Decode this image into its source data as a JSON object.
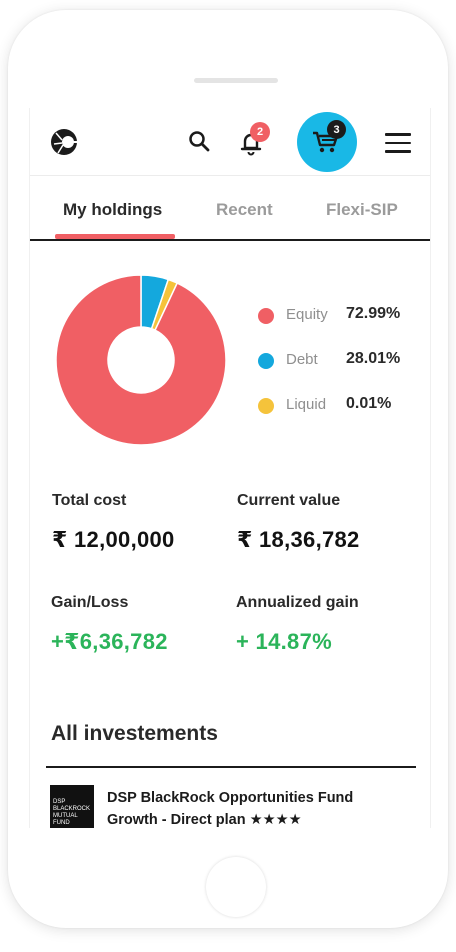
{
  "header": {
    "notifications_count": "2",
    "cart_count": "3",
    "colors": {
      "cart_bg": "#19b8e6",
      "badge": "#f05f64"
    }
  },
  "tabs": [
    {
      "label": "My holdings",
      "active": true
    },
    {
      "label": "Recent",
      "active": false
    },
    {
      "label": "Flexi-SIP",
      "active": false
    }
  ],
  "chart_data": {
    "type": "pie",
    "categories": [
      "Equity",
      "Debt",
      "Liquid"
    ],
    "values": [
      72.99,
      28.01,
      0.01
    ],
    "display_values": [
      "72.99%",
      "28.01%",
      "0.01%"
    ],
    "visual_shares": [
      0.93,
      0.052,
      0.018
    ],
    "colors": [
      "#f05f64",
      "#14a8dd",
      "#f5c33b"
    ],
    "legend_position": "right"
  },
  "stats": {
    "total_cost": {
      "label": "Total cost",
      "value": "₹ 12,00,000"
    },
    "current_value": {
      "label": "Current value",
      "value": "₹ 18,36,782"
    },
    "gain_loss": {
      "label": "Gain/Loss",
      "value": "+₹6,36,782"
    },
    "annualized_gain": {
      "label": "Annualized gain",
      "value": "+ 14.87%"
    }
  },
  "investments": {
    "title": "All investements",
    "items": [
      {
        "logo_text": "DSP BLACKROCK MUTUAL FUND",
        "name": "DSP BlackRock Opportunities Fund Growth - Direct plan ★★★★"
      }
    ]
  }
}
